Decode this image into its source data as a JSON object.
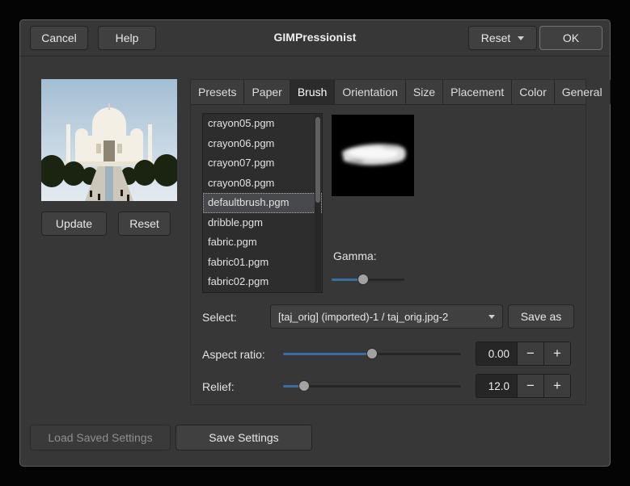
{
  "title": "GIMPressionist",
  "header": {
    "cancel_label": "Cancel",
    "help_label": "Help",
    "reset_label": "Reset",
    "ok_label": "OK"
  },
  "preview_panel": {
    "update_label": "Update",
    "reset_label": "Reset"
  },
  "tabs": [
    "Presets",
    "Paper",
    "Brush",
    "Orientation",
    "Size",
    "Placement",
    "Color",
    "General"
  ],
  "active_tab": "Brush",
  "brush_tab": {
    "brush_list": [
      "crayon05.pgm",
      "crayon06.pgm",
      "crayon07.pgm",
      "crayon08.pgm",
      "defaultbrush.pgm",
      "dribble.pgm",
      "fabric.pgm",
      "fabric01.pgm",
      "fabric02.pgm"
    ],
    "selected_brush": "defaultbrush.pgm",
    "gamma_label": "Gamma:",
    "select_label": "Select:",
    "select_value": "[taj_orig] (imported)-1 / taj_orig.jpg-2",
    "save_as_label": "Save as",
    "aspect_ratio_label": "Aspect ratio:",
    "aspect_ratio_value": "0.00",
    "relief_label": "Relief:",
    "relief_value": "12.0",
    "minus_label": "−",
    "plus_label": "+"
  },
  "footer": {
    "load_label": "Load Saved Settings",
    "save_label": "Save Settings"
  },
  "colors": {
    "dialog_bg": "#373737",
    "entry_bg": "#262626",
    "slider_accent": "#3f6c9e",
    "selection_bg": "#47494c"
  }
}
